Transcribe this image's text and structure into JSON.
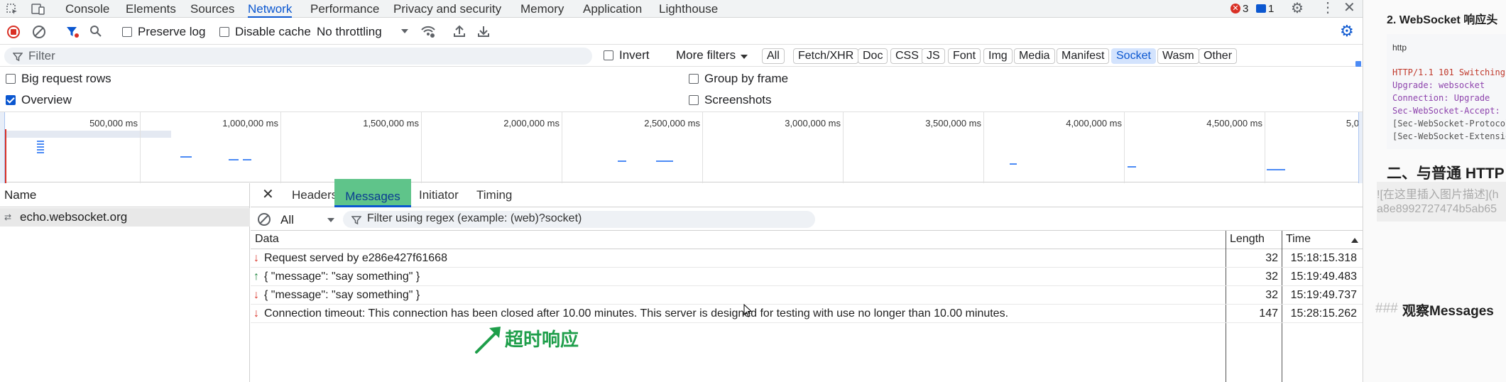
{
  "tabs": [
    "Console",
    "Elements",
    "Sources",
    "Network",
    "Performance",
    "Privacy and security",
    "Memory",
    "Application",
    "Lighthouse"
  ],
  "active_tab": "Network",
  "badges": {
    "errors": "3",
    "messages": "1"
  },
  "toolbar": {
    "preserve_log": "Preserve log",
    "disable_cache": "Disable cache",
    "throttling": "No throttling"
  },
  "filter": {
    "placeholder": "Filter",
    "invert": "Invert",
    "more_filters": "More filters",
    "types": [
      "All",
      "Fetch/XHR",
      "Doc",
      "CSS",
      "JS",
      "Font",
      "Img",
      "Media",
      "Manifest",
      "Socket",
      "Wasm",
      "Other"
    ],
    "active_type": "Socket"
  },
  "options": {
    "big_request_rows": "Big request rows",
    "overview": "Overview",
    "group_by_frame": "Group by frame",
    "screenshots": "Screenshots"
  },
  "timeline_ticks": [
    "500,000 ms",
    "1,000,000 ms",
    "1,500,000 ms",
    "2,000,000 ms",
    "2,500,000 ms",
    "3,000,000 ms",
    "3,500,000 ms",
    "4,000,000 ms",
    "4,500,000 ms",
    "5,0"
  ],
  "name_pane": {
    "header": "Name",
    "items": [
      "echo.websocket.org"
    ]
  },
  "detail_tabs": [
    "Headers",
    "Messages",
    "Initiator",
    "Timing"
  ],
  "active_detail_tab": "Messages",
  "messages_filter": {
    "select": "All",
    "placeholder": "Filter using regex (example: (web)?socket)"
  },
  "messages_table": {
    "headers": {
      "data": "Data",
      "length": "Length",
      "time": "Time"
    },
    "rows": [
      {
        "dir": "down",
        "data": "Request served by e286e427f61668",
        "length": "32",
        "time": "15:18:15.318"
      },
      {
        "dir": "up",
        "data": "{ \"message\": \"say something\" }",
        "length": "32",
        "time": "15:19:49.483"
      },
      {
        "dir": "down",
        "data": "{ \"message\": \"say something\" }",
        "length": "32",
        "time": "15:19:49.737"
      },
      {
        "dir": "down",
        "data": "Connection timeout: This connection has been closed after 10.00 minutes. This server is designed for testing with use no longer than 10.00 minutes.",
        "length": "147",
        "time": "15:28:15.262"
      }
    ]
  },
  "annotation": "超时响应",
  "right_pane": {
    "heading": "2. WebSocket 响应头",
    "code_lang": "http",
    "code_lines": [
      "HTTP/1.1 101 Switching",
      "Upgrade: websocket",
      "Connection: Upgrade",
      "Sec-WebSocket-Accept: s",
      "[Sec-WebSocket-Protocol",
      "[Sec-WebSocket-Extension"
    ],
    "section_heading": "二、与普通 HTTP",
    "image_placeholder_1": "![在这里插入图片描述](h",
    "image_placeholder_2": "a8e8992727474b5ab65",
    "md_heading_marker": "###",
    "md_heading_text": "观察Messages"
  },
  "colors": {
    "accent": "#0b57d0",
    "error": "#d93025",
    "up": "#188038",
    "annotation": "#1e9e4a",
    "highlight": "#5fc48a"
  }
}
